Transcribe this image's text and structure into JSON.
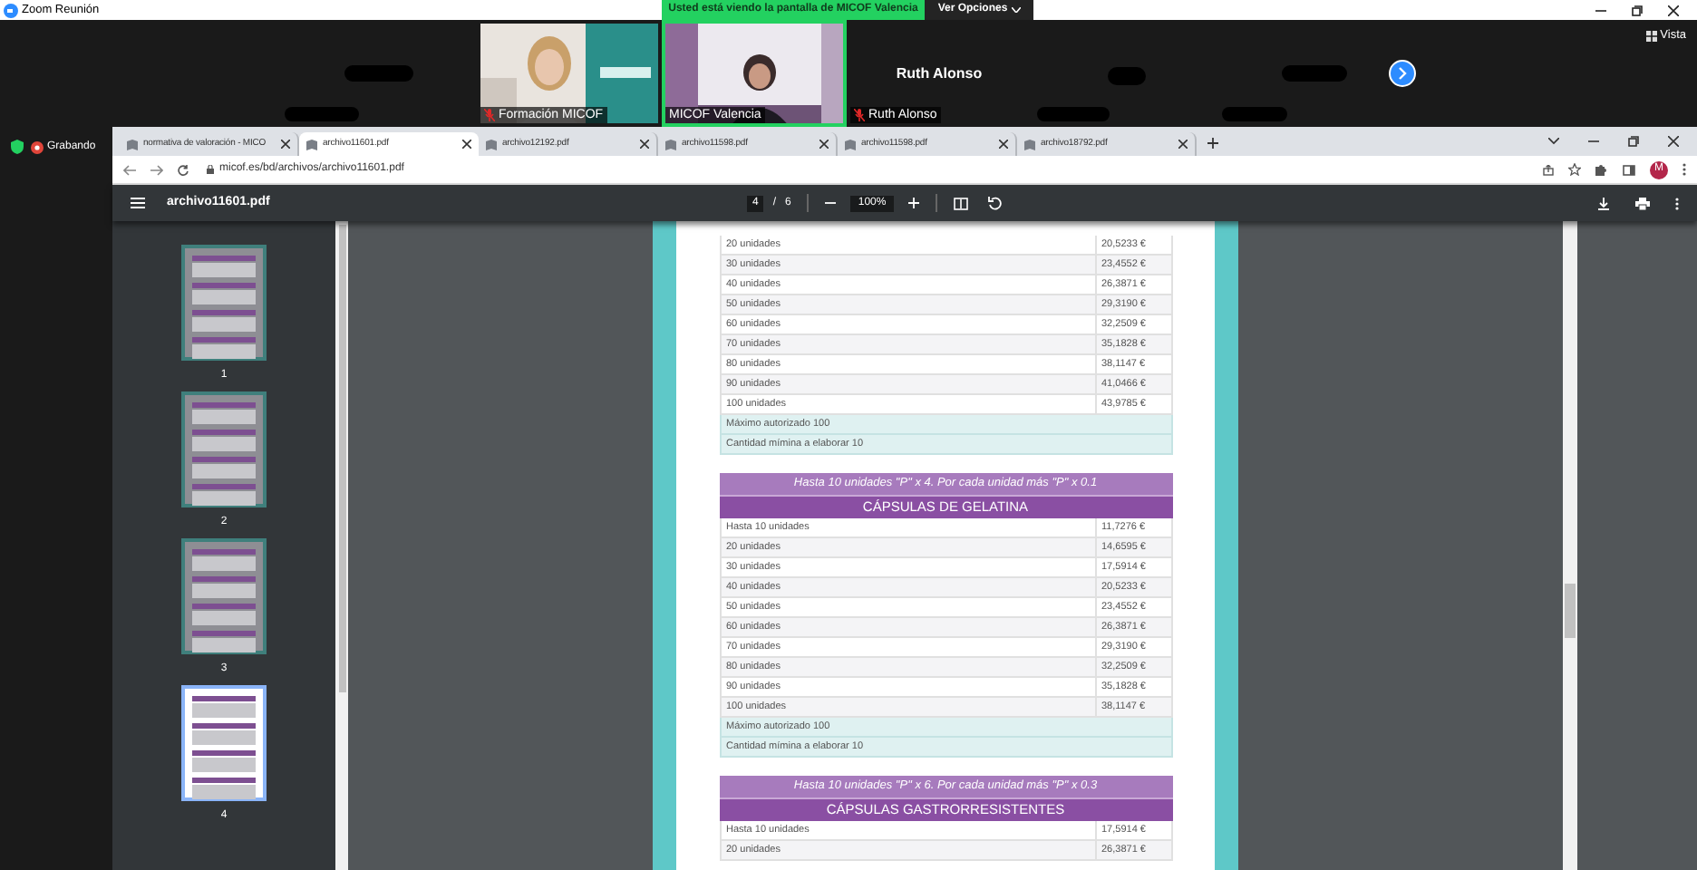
{
  "zoom": {
    "title": "Zoom Reunión",
    "banner": "Usted está viendo la pantalla de MICOF Valencia",
    "options_button": "Ver Opciones",
    "view_button": "Vista",
    "recording": "Grabando",
    "participants": [
      {
        "kind": "video",
        "name": "Formación MICOF",
        "muted": true,
        "active": false
      },
      {
        "kind": "video",
        "name": "MICOF Valencia",
        "muted": false,
        "active": true
      },
      {
        "kind": "avatar",
        "display": "Ruth Alonso",
        "name": "Ruth Alonso",
        "muted": true,
        "active": false
      }
    ]
  },
  "browser": {
    "tabs": [
      {
        "label": "normativa de valoración - MICO",
        "selected": false
      },
      {
        "label": "archivo11601.pdf",
        "selected": true
      },
      {
        "label": "archivo12192.pdf",
        "selected": false
      },
      {
        "label": "archivo11598.pdf",
        "selected": false
      },
      {
        "label": "archivo11598.pdf",
        "selected": false
      },
      {
        "label": "archivo18792.pdf",
        "selected": false
      }
    ],
    "url": "micof.es/bd/archivos/archivo11601.pdf",
    "profile": "M"
  },
  "pdf": {
    "file": "archivo11601.pdf",
    "page": "4",
    "pages": "6",
    "zoom": "100%",
    "page_separator": "/",
    "thumbnails": [
      {
        "label": "1",
        "selected": false
      },
      {
        "label": "2",
        "selected": false
      },
      {
        "label": "3",
        "selected": false
      },
      {
        "label": "4",
        "selected": true
      }
    ],
    "sections": [
      {
        "rows": [
          {
            "label": "20 unidades",
            "price": "20,5233 €"
          },
          {
            "label": "30 unidades",
            "price": "23,4552 €"
          },
          {
            "label": "40 unidades",
            "price": "26,3871 €"
          },
          {
            "label": "50 unidades",
            "price": "29,3190 €"
          },
          {
            "label": "60 unidades",
            "price": "32,2509 €"
          },
          {
            "label": "70 unidades",
            "price": "35,1828 €"
          },
          {
            "label": "80 unidades",
            "price": "38,1147 €"
          },
          {
            "label": "90 unidades",
            "price": "41,0466 €"
          },
          {
            "label": "100 unidades",
            "price": "43,9785 €"
          }
        ],
        "notes": [
          "Máximo autorizado 100",
          "Cantidad mímina a elaborar 10"
        ]
      },
      {
        "formula": "Hasta 10 unidades \"P\" x 4. Por cada unidad más \"P\" x 0.1",
        "title": "CÁPSULAS DE GELATINA",
        "rows": [
          {
            "label": "Hasta 10 unidades",
            "price": "11,7276 €"
          },
          {
            "label": "20 unidades",
            "price": "14,6595 €"
          },
          {
            "label": "30 unidades",
            "price": "17,5914 €"
          },
          {
            "label": "40 unidades",
            "price": "20,5233 €"
          },
          {
            "label": "50 unidades",
            "price": "23,4552 €"
          },
          {
            "label": "60 unidades",
            "price": "26,3871 €"
          },
          {
            "label": "70 unidades",
            "price": "29,3190 €"
          },
          {
            "label": "80 unidades",
            "price": "32,2509 €"
          },
          {
            "label": "90 unidades",
            "price": "35,1828 €"
          },
          {
            "label": "100 unidades",
            "price": "38,1147 €"
          }
        ],
        "notes": [
          "Máximo autorizado 100",
          "Cantidad mímina a elaborar 10"
        ]
      },
      {
        "formula": "Hasta 10 unidades \"P\" x 6. Por cada unidad más \"P\" x 0.3",
        "title": "CÁPSULAS GASTRORRESISTENTES",
        "rows": [
          {
            "label": "Hasta 10 unidades",
            "price": "17,5914 €"
          },
          {
            "label": "20 unidades",
            "price": "26,3871 €"
          }
        ]
      }
    ]
  }
}
